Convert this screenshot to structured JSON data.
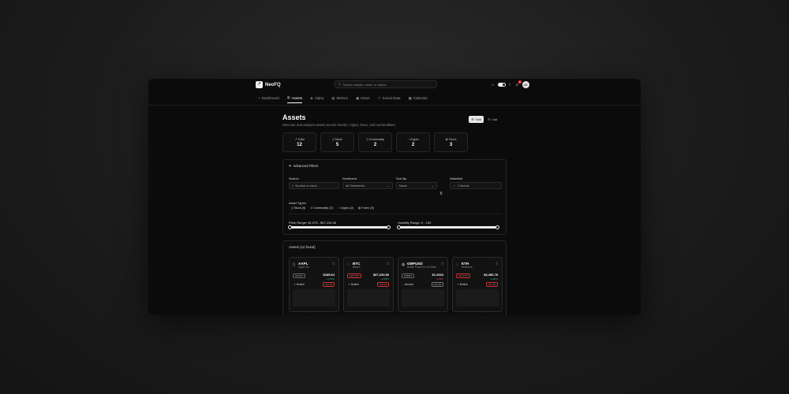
{
  "app": {
    "name": "NeoFQ",
    "logo_glyph": "↗"
  },
  "search": {
    "placeholder": "Search assets, news, or topics..."
  },
  "toolbar": {
    "sun_icon": "☼",
    "moon_icon": "☾",
    "notifications_count": "3",
    "avatar_initials": "JC"
  },
  "nav": {
    "items": [
      {
        "label": "Dashboard",
        "icon": "⌁"
      },
      {
        "label": "Assets",
        "icon": "◎"
      },
      {
        "label": "Alpha",
        "icon": "◈"
      },
      {
        "label": "Metrics",
        "icon": "▤"
      },
      {
        "label": "News",
        "icon": "▣"
      },
      {
        "label": "Social Data",
        "icon": "⚇"
      },
      {
        "label": "Calendar",
        "icon": "▦"
      }
    ],
    "active": "Assets"
  },
  "page": {
    "title": "Assets",
    "subtitle": "Discover and analyze assets across stocks, crypto, forex, and commodities",
    "view_grid": "Grid",
    "view_list": "List"
  },
  "stats": [
    {
      "label": "Total",
      "value": "12",
      "icon": "↗"
    },
    {
      "label": "Stock",
      "value": "5",
      "icon": "▯"
    },
    {
      "label": "Commodity",
      "value": "2",
      "icon": "⬦"
    },
    {
      "label": "Crypto",
      "value": "2",
      "icon": "◌"
    },
    {
      "label": "Forex",
      "value": "3",
      "icon": "◍"
    }
  ],
  "filters": {
    "title": "Advanced Filters",
    "search_label": "Search",
    "search_placeholder": "Symbol or name...",
    "sentiment_label": "Sentiment",
    "sentiment_value": "All Sentiments",
    "sort_label": "Sort By",
    "sort_value": "Name",
    "watchlist_label": "Watchlist",
    "watchlist_value": "0 Assets",
    "asset_types_label": "Asset Types",
    "types": [
      {
        "label": "Stock (5)",
        "icon": "▯"
      },
      {
        "label": "Commodity (2)",
        "icon": "⬦"
      },
      {
        "label": "Crypto (2)",
        "icon": "◌"
      },
      {
        "label": "Forex (3)",
        "icon": "◍"
      }
    ],
    "price_range_label": "Price Range: $1.075 - $67,234.56",
    "volatility_range_label": "Volatility Range: 0 - 100"
  },
  "assets": {
    "count_label": "Assets (12 found)",
    "cards": [
      {
        "symbol": "AAPL",
        "name": "Apple Inc.",
        "icon": "▯",
        "tag": "STOCK",
        "tag_color": "grey",
        "price": "$185.64",
        "change": "+1.33%",
        "change_dir": "pos",
        "sentiment": "Bullish",
        "rank": "Top 40"
      },
      {
        "symbol": "BTC",
        "name": "Bitcoin",
        "icon": "◌",
        "tag": "CRYPTO",
        "tag_color": "red",
        "price": "$67,234.56",
        "change": "+2.89%",
        "change_dir": "pos",
        "sentiment": "Bullish",
        "rank": "Top 10"
      },
      {
        "symbol": "GBPUSD",
        "name": "British Pound to US Dollar",
        "icon": "◍",
        "tag": "FOREX",
        "tag_color": "grey",
        "price": "$1.2634",
        "change": "-0.08%",
        "change_dir": "neg",
        "sentiment": "Neutral",
        "rank": "Top 50"
      },
      {
        "symbol": "ETH",
        "name": "Ethereum",
        "icon": "◌",
        "tag": "CRYPTO",
        "tag_color": "red",
        "price": "$3,456.78",
        "change": "+1.82%",
        "change_dir": "pos",
        "sentiment": "Bullish",
        "rank": "Top 10"
      }
    ]
  }
}
